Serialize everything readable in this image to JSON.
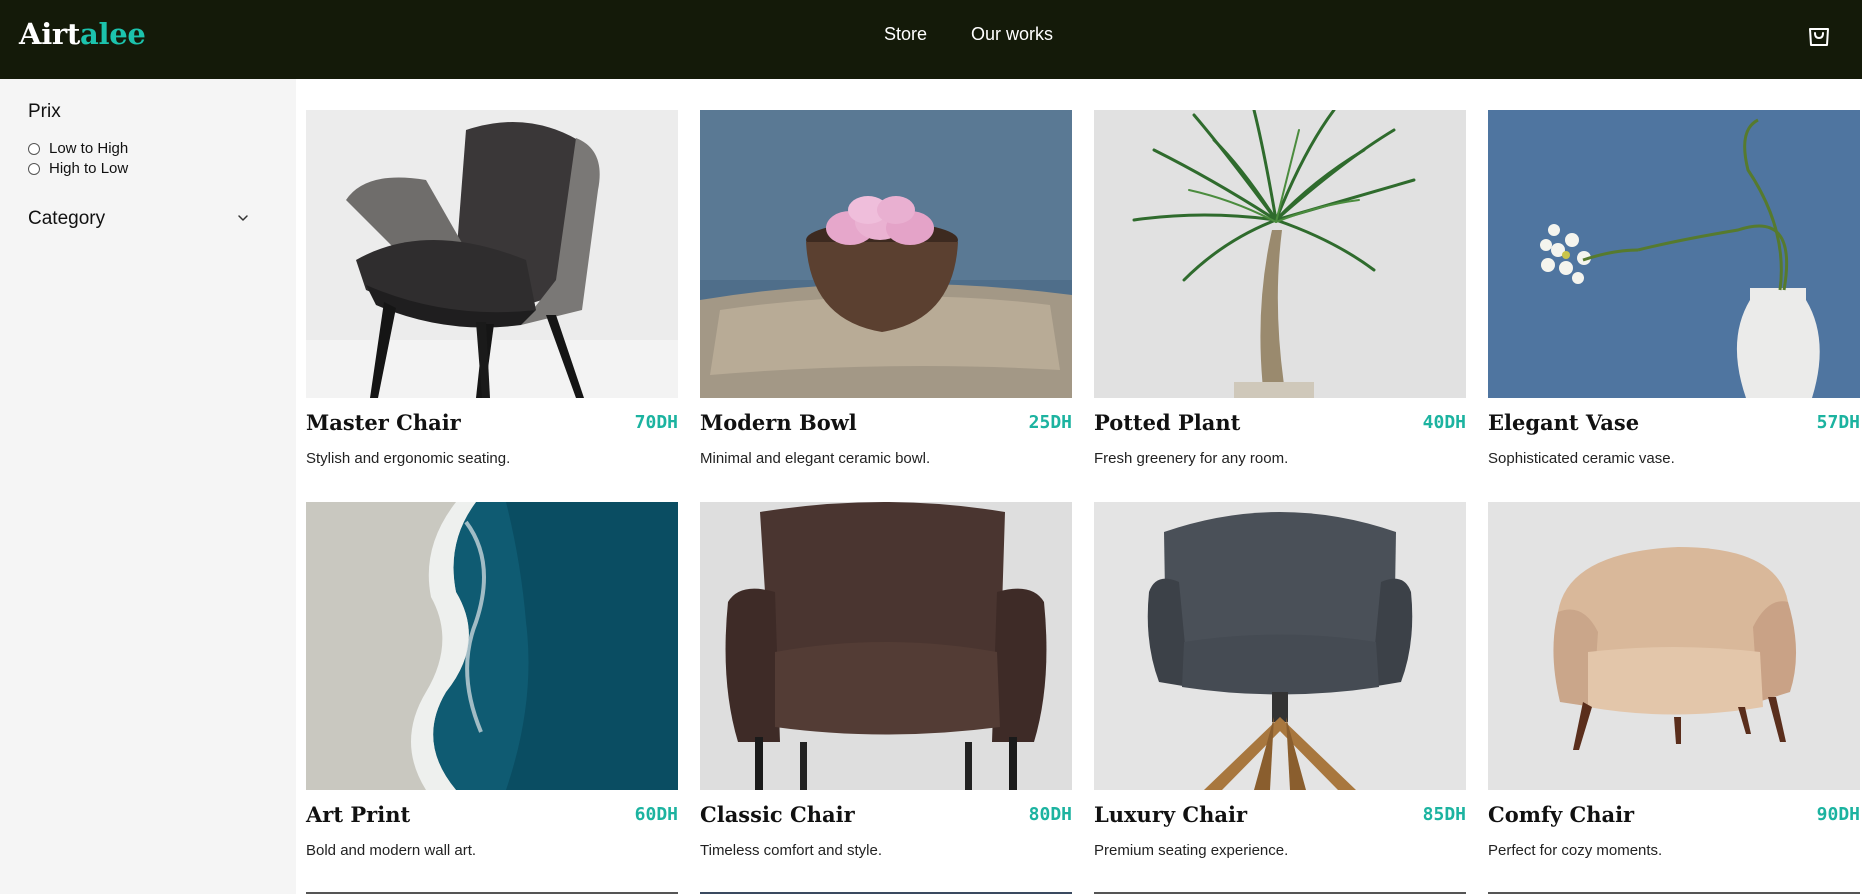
{
  "header": {
    "logo_primary": "Airt",
    "logo_accent": "alee",
    "nav": [
      "Store",
      "Our works"
    ],
    "cart_icon": "shopping-bag-icon",
    "colors": {
      "background": "#141a09",
      "accent": "#1cc3ad"
    }
  },
  "sidebar": {
    "price_title": "Prix",
    "sort_options": [
      "Low to High",
      "High to Low"
    ],
    "category_title": "Category",
    "category_icon": "chevron-down-icon"
  },
  "products": [
    {
      "name": "Master Chair",
      "price": "70DH",
      "description": "Stylish and ergonomic seating.",
      "image": "grey-armchair"
    },
    {
      "name": "Modern Bowl",
      "price": "25DH",
      "description": "Minimal and elegant ceramic bowl.",
      "image": "wooden-bowl-pink-eggs"
    },
    {
      "name": "Potted Plant",
      "price": "40DH",
      "description": "Fresh greenery for any room.",
      "image": "palm-plant"
    },
    {
      "name": "Elegant Vase",
      "price": "57DH",
      "description": "Sophisticated ceramic vase.",
      "image": "white-vase-flower"
    },
    {
      "name": "Art Print",
      "price": "60DH",
      "description": "Bold and modern wall art.",
      "image": "ocean-aerial"
    },
    {
      "name": "Classic Chair",
      "price": "80DH",
      "description": "Timeless comfort and style.",
      "image": "brown-leather-chair"
    },
    {
      "name": "Luxury Chair",
      "price": "85DH",
      "description": "Premium seating experience.",
      "image": "dark-swivel-chair"
    },
    {
      "name": "Comfy Chair",
      "price": "90DH",
      "description": "Perfect for cozy moments.",
      "image": "beige-armchair"
    }
  ],
  "price_color": "#1cb3a0"
}
